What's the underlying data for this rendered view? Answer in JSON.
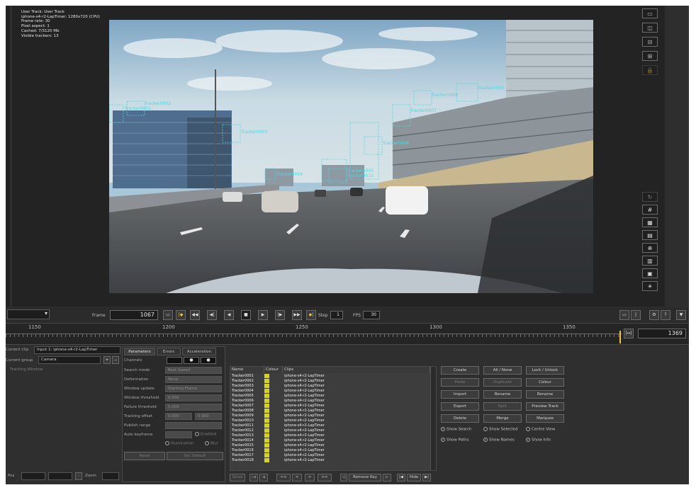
{
  "viewer": {
    "info_lines": [
      "User Track: User Track",
      "iphone-s4-r2-LapTimer: 1280x720 (CPU)",
      "Frame rate: 30",
      "Pixel aspect: 1",
      "Cached: 7/3120 Mb",
      "Visible trackers: 13"
    ],
    "tracker_labels": [
      "Tracker0001",
      "Tracker0002",
      "Tracker0003",
      "Tracker0004",
      "Tracker0005",
      "Tracker0006",
      "Tracker0007",
      "Tracker0008",
      "Tracker0009",
      "Tracker0010",
      "Tracker0011",
      "Tracker0012",
      "Tracker0013"
    ],
    "tracker_color": "#4fd8e0"
  },
  "side_toolbar": {
    "top_icons": [
      "single-view-icon",
      "split-vertical-icon",
      "split-horizontal-icon",
      "quad-view-icon",
      "lock-icon"
    ],
    "bottom_icons": [
      "refresh-icon",
      "grid-icon",
      "grid-dense-icon",
      "grid-small-icon",
      "crosshair-grid-icon",
      "film-strip-icon",
      "frame-grid-icon",
      "sun-icon"
    ]
  },
  "transport": {
    "view_select": "",
    "frame_label": "Frame",
    "frame_value": "1067",
    "step_label": "Step",
    "step_value": "1",
    "fps_label": "FPS",
    "fps_value": "30",
    "buttons": [
      "frame-icon",
      "key-prev-icon",
      "rewind-start-icon",
      "step-back-icon",
      "play-reverse-icon",
      "stop-icon",
      "play-icon",
      "step-forward-icon",
      "fast-forward-end-icon",
      "key-next-icon"
    ]
  },
  "timeline": {
    "ticks": [
      "1150",
      "1200",
      "1250",
      "1300",
      "1350"
    ],
    "end_frame": "1369",
    "playhead_color": "#f2c53d"
  },
  "clip_panel": {
    "current_clip_label": "Current clip",
    "current_clip_value": "Input 1: iphone-s4-r2-LapTimer",
    "current_group_label": "Current group",
    "current_group_value": "Camera",
    "tracking_window_label": "Tracking Window",
    "pos_label": "Pos",
    "zoom_label": "Zoom"
  },
  "params": {
    "tabs": [
      "Parameters",
      "Errors",
      "Acceleration"
    ],
    "rows": [
      {
        "label": "Channels",
        "value": ""
      },
      {
        "label": "Search mode",
        "value": "Best Speed"
      },
      {
        "label": "Deformation",
        "value": "None"
      },
      {
        "label": "Window update",
        "value": "Starting Frame"
      },
      {
        "label": "Window threshold",
        "value": "0.000"
      },
      {
        "label": "Failure threshold",
        "value": "0.000"
      },
      {
        "label": "Tracking offset",
        "value": "0.000",
        "value2": "0.000"
      },
      {
        "label": "Publish range",
        "value": ""
      },
      {
        "label": "Auto keyframe",
        "value": "",
        "check": "Enabled"
      }
    ],
    "check_illumination": "Illumination",
    "check_blur": "Blur",
    "reset": "Reset",
    "set_default": "Set Default"
  },
  "tracker_list": {
    "headers": [
      "Name",
      "Colour",
      "Clips"
    ],
    "rows": [
      {
        "name": "Tracker0001",
        "clip": "iphone-s4-r2-LapTimer"
      },
      {
        "name": "Tracker0002",
        "clip": "iphone-s4-r2-LapTimer"
      },
      {
        "name": "Tracker0003",
        "clip": "iphone-s4-r2-LapTimer"
      },
      {
        "name": "Tracker0004",
        "clip": "iphone-s4-r2-LapTimer"
      },
      {
        "name": "Tracker0005",
        "clip": "iphone-s4-r2-LapTimer"
      },
      {
        "name": "Tracker0006",
        "clip": "iphone-s4-r2-LapTimer"
      },
      {
        "name": "Tracker0007",
        "clip": "iphone-s4-r2-LapTimer"
      },
      {
        "name": "Tracker0008",
        "clip": "iphone-s4-r2-LapTimer"
      },
      {
        "name": "Tracker0009",
        "clip": "iphone-s4-r2-LapTimer"
      },
      {
        "name": "Tracker0010",
        "clip": "iphone-s4-r2-LapTimer"
      },
      {
        "name": "Tracker0011",
        "clip": "iphone-s4-r2-LapTimer"
      },
      {
        "name": "Tracker0012",
        "clip": "iphone-s4-r2-LapTimer"
      },
      {
        "name": "Tracker0013",
        "clip": "iphone-s4-r2-LapTimer"
      },
      {
        "name": "Tracker0014",
        "clip": "iphone-s4-r2-LapTimer"
      },
      {
        "name": "Tracker0015",
        "clip": "iphone-s4-r2-LapTimer"
      },
      {
        "name": "Tracker0016",
        "clip": "iphone-s4-r2-LapTimer"
      },
      {
        "name": "Tracker0017",
        "clip": "iphone-s4-r2-LapTimer"
      },
      {
        "name": "Tracker0018",
        "clip": "iphone-s4-r2-LapTimer"
      }
    ],
    "swatch_color": "#d6d21e",
    "nav": {
      "solve": "Solve",
      "prev_prev": "<<",
      "prev": "<",
      "next": ">",
      "next_next": ">>",
      "remove_key": "Remove Key",
      "hide": "Hide"
    }
  },
  "actions": {
    "buttons": [
      {
        "label": "Create",
        "enabled": true
      },
      {
        "label": "All / None",
        "enabled": true
      },
      {
        "label": "Lock / Unlock",
        "enabled": true
      },
      {
        "label": "Paste",
        "enabled": false
      },
      {
        "label": "Duplicate",
        "enabled": false
      },
      {
        "label": "Colour",
        "enabled": true
      },
      {
        "label": "Import",
        "enabled": true
      },
      {
        "label": "Rename",
        "enabled": true
      },
      {
        "label": "Rename",
        "enabled": true
      },
      {
        "label": "Export",
        "enabled": true
      },
      {
        "label": "Split",
        "enabled": false
      },
      {
        "label": "Preview Track",
        "enabled": true
      },
      {
        "label": "Delete",
        "enabled": true
      },
      {
        "label": "Merge",
        "enabled": true
      },
      {
        "label": "Marquee",
        "enabled": true
      }
    ],
    "checks": [
      {
        "label": "Show Search",
        "checked": true
      },
      {
        "label": "Show Selected",
        "checked": false
      },
      {
        "label": "Centre View",
        "checked": false
      },
      {
        "label": "Show Paths",
        "checked": true
      },
      {
        "label": "Show Names",
        "checked": true
      },
      {
        "label": "Show Info",
        "checked": true
      }
    ]
  }
}
